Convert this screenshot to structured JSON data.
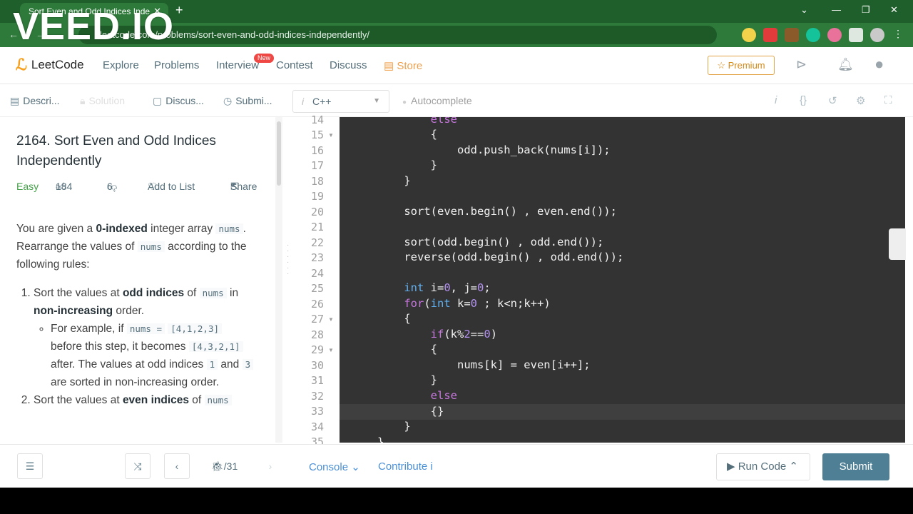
{
  "browser": {
    "tab_title": "Sort Even and Odd Indices Inde",
    "tab_close": "✕",
    "new_tab": "+",
    "url_prefix": "leetcode.com/problems/",
    "url_path": "sort-even-and-odd-indices-independently/",
    "watermark": "VEED.IO",
    "win_min": "—",
    "win_max": "❐",
    "win_close": "✕",
    "win_menu": "⌄"
  },
  "nav": {
    "logo": "LeetCode",
    "links": [
      "Explore",
      "Problems",
      "Interview",
      "Contest",
      "Discuss",
      "Store"
    ],
    "new_badge": "New",
    "premium": "☆ Premium"
  },
  "subbar": {
    "tabs": [
      "Descri...",
      "Solution",
      "Discus...",
      "Submi..."
    ],
    "language": "C++",
    "autocomplete": "Autocomplete"
  },
  "problem": {
    "title": "2164. Sort Even and Odd Indices Independently",
    "difficulty": "Easy",
    "likes": "184",
    "dislikes": "6",
    "add_to_list": "Add to List",
    "share": "Share",
    "intro_1": "You are given a ",
    "intro_bold": "0-indexed",
    "intro_2": " integer array ",
    "intro_code": "nums",
    "intro_3": ". Rearrange the values of ",
    "intro_code2": "nums",
    "intro_4": " according to the following rules:",
    "rule1_a": "Sort the values at ",
    "rule1_b": "odd indices",
    "rule1_c": " of ",
    "rule1_code": "nums",
    "rule1_d": " in ",
    "rule1_e": "non-increasing",
    "rule1_f": " order.",
    "ex_a": "For example, if ",
    "ex_code1": "nums =",
    "ex_code2": "[4,1,2,3]",
    "ex_b": " before this step, it becomes ",
    "ex_code3": "[4,3,2,1]",
    "ex_c": " after. The values at odd indices ",
    "ex_code4": "1",
    "ex_d": " and ",
    "ex_code5": "3",
    "ex_e": " are sorted in non-increasing order.",
    "rule2_a": "Sort the values at ",
    "rule2_b": "even indices",
    "rule2_c": " of ",
    "rule2_code": "nums"
  },
  "code": {
    "line_numbers": [
      "14",
      "15",
      "16",
      "17",
      "18",
      "19",
      "20",
      "21",
      "22",
      "23",
      "24",
      "25",
      "26",
      "27",
      "28",
      "29",
      "30",
      "31",
      "32",
      "33",
      "34",
      "35"
    ]
  },
  "bottom": {
    "page": "/31",
    "console": "Console ⌄",
    "contribute": "Contribute i",
    "run": "▶ Run Code ⌃",
    "submit": "Submit"
  }
}
